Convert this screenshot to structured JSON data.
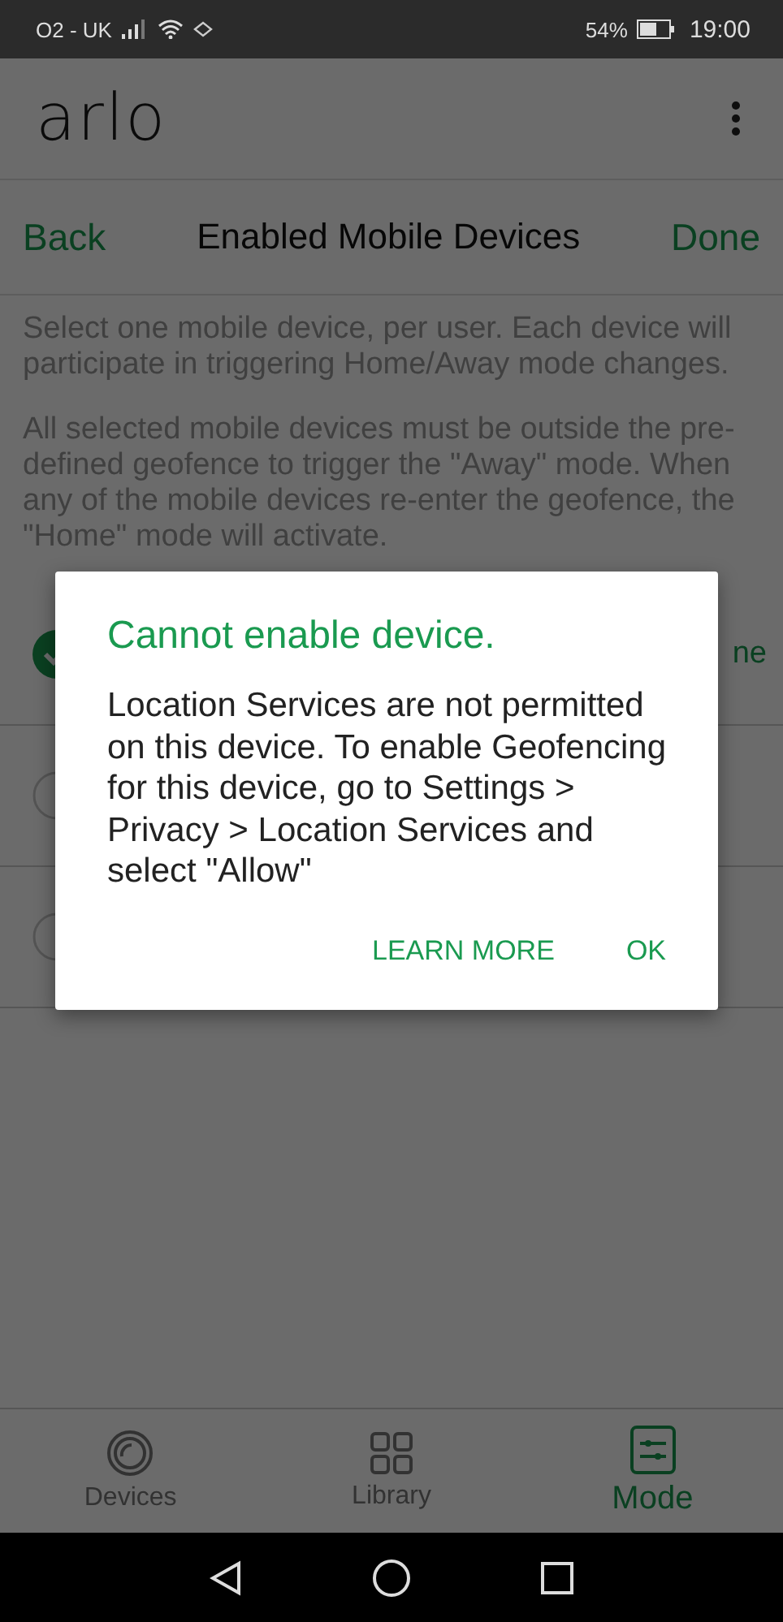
{
  "status_bar": {
    "carrier": "O2 - UK",
    "battery_percent": "54%",
    "time": "19:00"
  },
  "app_bar": {
    "logo": "arlo"
  },
  "header": {
    "back": "Back",
    "title": "Enabled Mobile Devices",
    "done": "Done"
  },
  "description": [
    "Select one mobile device, per user. Each device will participate in triggering Home/Away mode changes.",
    "All selected mobile devices must be outside the pre-defined geofence to trigger the \"Away\" mode. When any of the mobile devices re-enter the geofence, the \"Home\" mode will activate."
  ],
  "devices": [
    {
      "selected": true,
      "trailing_text": "ne"
    },
    {
      "selected": false
    },
    {
      "selected": false
    }
  ],
  "dialog": {
    "title": "Cannot enable device.",
    "message": "Location Services are not permitted on this device. To enable Geofencing for this device, go to Settings > Privacy > Location Services and select \"Allow\"",
    "buttons": [
      "LEARN MORE",
      "OK"
    ]
  },
  "tabs": [
    {
      "label": "Devices",
      "kind": "devices",
      "selected": false
    },
    {
      "label": "Library",
      "kind": "library",
      "selected": false
    },
    {
      "label": "Mode",
      "kind": "mode",
      "selected": true
    }
  ]
}
